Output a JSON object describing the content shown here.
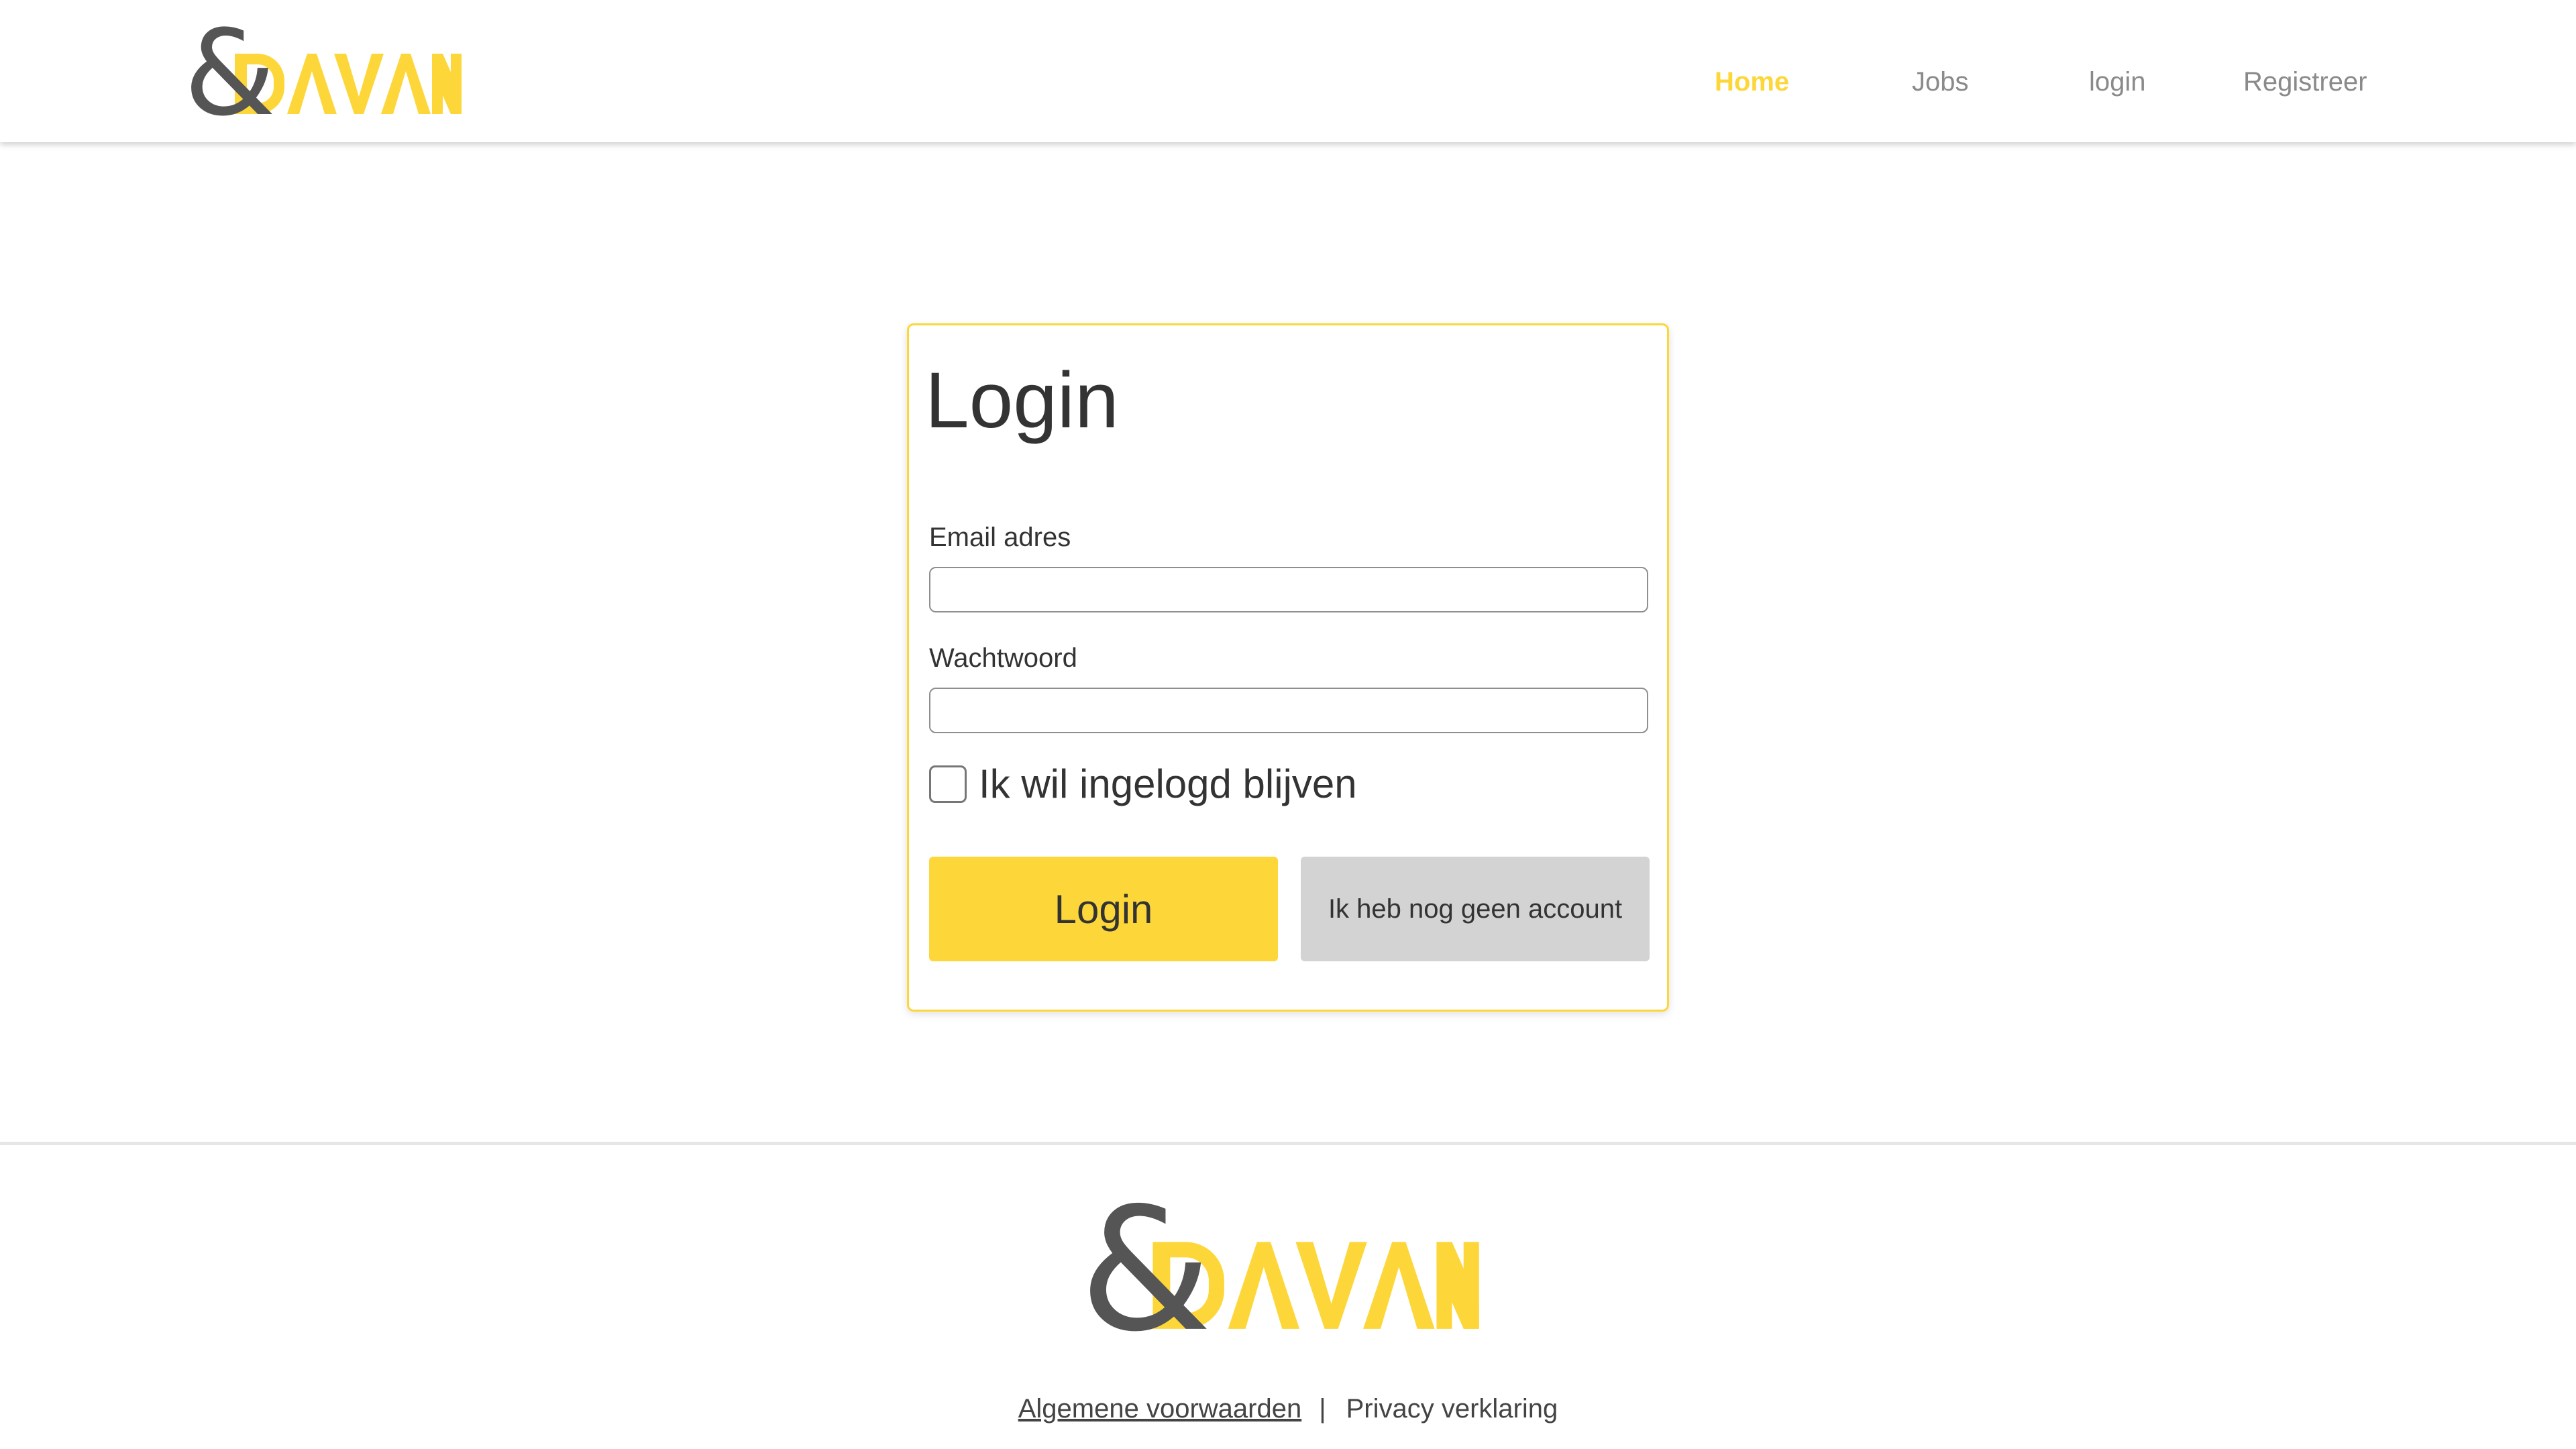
{
  "brand": {
    "logo_text": "DAVANT",
    "logo_symbol": "&",
    "colors": {
      "accent": "#fdd73a",
      "logo_dark": "#555555"
    }
  },
  "nav": {
    "items": [
      {
        "label": "Home",
        "active": true
      },
      {
        "label": "Jobs",
        "active": false
      },
      {
        "label": "login",
        "active": false
      },
      {
        "label": "Registreer",
        "active": false
      }
    ]
  },
  "login_form": {
    "title": "Login",
    "email": {
      "label": "Email adres",
      "value": ""
    },
    "password": {
      "label": "Wachtwoord",
      "value": ""
    },
    "remember": {
      "label": "Ik wil ingelogd blijven",
      "checked": false
    },
    "submit_label": "Login",
    "no_account_label": "Ik heb nog geen account"
  },
  "footer": {
    "terms_label": "Algemene voorwaarden",
    "separator": "|",
    "privacy_label": "Privacy verklaring"
  }
}
